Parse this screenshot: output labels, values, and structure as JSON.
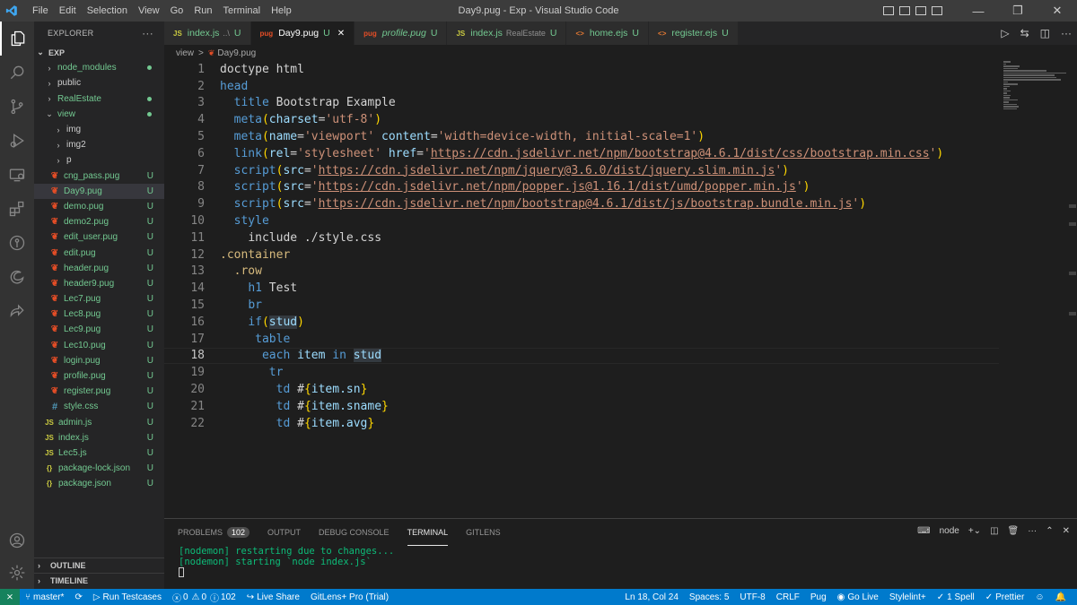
{
  "titlebar": {
    "menu": [
      "File",
      "Edit",
      "Selection",
      "View",
      "Go",
      "Run",
      "Terminal",
      "Help"
    ],
    "title": "Day9.pug - Exp - Visual Studio Code"
  },
  "sidebar": {
    "header": "EXPLORER",
    "more": "···",
    "root": "EXP",
    "items": [
      {
        "label": "node_modules",
        "type": "folder",
        "status": "dot"
      },
      {
        "label": "public",
        "type": "folder",
        "status": ""
      },
      {
        "label": "RealEstate",
        "type": "folder",
        "status": "dot"
      },
      {
        "label": "view",
        "type": "folder-open",
        "status": "dot"
      },
      {
        "label": "img",
        "type": "subfolder",
        "status": ""
      },
      {
        "label": "img2",
        "type": "subfolder",
        "status": ""
      },
      {
        "label": "p",
        "type": "subfolder",
        "status": ""
      },
      {
        "label": "cng_pass.pug",
        "type": "pug",
        "status": "U"
      },
      {
        "label": "Day9.pug",
        "type": "pug",
        "status": "U"
      },
      {
        "label": "demo.pug",
        "type": "pug",
        "status": "U"
      },
      {
        "label": "demo2.pug",
        "type": "pug",
        "status": "U"
      },
      {
        "label": "edit_user.pug",
        "type": "pug",
        "status": "U"
      },
      {
        "label": "edit.pug",
        "type": "pug",
        "status": "U"
      },
      {
        "label": "header.pug",
        "type": "pug",
        "status": "U"
      },
      {
        "label": "header9.pug",
        "type": "pug",
        "status": "U"
      },
      {
        "label": "Lec7.pug",
        "type": "pug",
        "status": "U"
      },
      {
        "label": "Lec8.pug",
        "type": "pug",
        "status": "U"
      },
      {
        "label": "Lec9.pug",
        "type": "pug",
        "status": "U"
      },
      {
        "label": "Lec10.pug",
        "type": "pug",
        "status": "U"
      },
      {
        "label": "login.pug",
        "type": "pug",
        "status": "U"
      },
      {
        "label": "profile.pug",
        "type": "pug",
        "status": "U"
      },
      {
        "label": "register.pug",
        "type": "pug",
        "status": "U"
      },
      {
        "label": "style.css",
        "type": "css",
        "status": "U"
      },
      {
        "label": "admin.js",
        "type": "js",
        "status": "U"
      },
      {
        "label": "index.js",
        "type": "js",
        "status": "U"
      },
      {
        "label": "Lec5.js",
        "type": "js",
        "status": "U"
      },
      {
        "label": "package-lock.json",
        "type": "json",
        "status": "U"
      },
      {
        "label": "package.json",
        "type": "json",
        "status": "U"
      }
    ],
    "outline": "OUTLINE",
    "timeline": "TIMELINE"
  },
  "tabs": [
    {
      "icon": "JS",
      "label": "index.js",
      "sub": "..\\",
      "status": "U",
      "active": false,
      "italic": false
    },
    {
      "icon": "pug",
      "label": "Day9.pug",
      "sub": "",
      "status": "U",
      "active": true,
      "italic": false
    },
    {
      "icon": "pug",
      "label": "profile.pug",
      "sub": "",
      "status": "U",
      "active": false,
      "italic": true
    },
    {
      "icon": "JS",
      "label": "index.js",
      "sub": "RealEstate",
      "status": "U",
      "active": false,
      "italic": false
    },
    {
      "icon": "<>",
      "label": "home.ejs",
      "sub": "",
      "status": "U",
      "active": false,
      "italic": false
    },
    {
      "icon": "<>",
      "label": "register.ejs",
      "sub": "",
      "status": "U",
      "active": false,
      "italic": false
    }
  ],
  "breadcrumb": {
    "folder": "view",
    "sep": ">",
    "file": "Day9.pug"
  },
  "code": {
    "current_line": 18,
    "lines": [
      [
        [
          "w",
          "doctype html"
        ]
      ],
      [
        [
          "k",
          "head"
        ]
      ],
      [
        [
          "w",
          "  "
        ],
        [
          "k",
          "title"
        ],
        [
          "w",
          " Bootstrap Example"
        ]
      ],
      [
        [
          "w",
          "  "
        ],
        [
          "k",
          "meta"
        ],
        [
          "br",
          "("
        ],
        [
          "v",
          "charset"
        ],
        [
          "w",
          "="
        ],
        [
          "s",
          "'utf-8'"
        ],
        [
          "br",
          ")"
        ]
      ],
      [
        [
          "w",
          "  "
        ],
        [
          "k",
          "meta"
        ],
        [
          "br",
          "("
        ],
        [
          "v",
          "name"
        ],
        [
          "w",
          "="
        ],
        [
          "s",
          "'viewport'"
        ],
        [
          "w",
          " "
        ],
        [
          "v",
          "content"
        ],
        [
          "w",
          "="
        ],
        [
          "s",
          "'width=device-width, initial-scale=1'"
        ],
        [
          "br",
          ")"
        ]
      ],
      [
        [
          "w",
          "  "
        ],
        [
          "k",
          "link"
        ],
        [
          "br",
          "("
        ],
        [
          "v",
          "rel"
        ],
        [
          "w",
          "="
        ],
        [
          "s",
          "'stylesheet'"
        ],
        [
          "w",
          " "
        ],
        [
          "v",
          "href"
        ],
        [
          "w",
          "="
        ],
        [
          "s",
          "'"
        ],
        [
          "su",
          "https://cdn.jsdelivr.net/npm/bootstrap@4.6.1/dist/css/bootstrap.min.css"
        ],
        [
          "s",
          "'"
        ],
        [
          "br",
          ")"
        ]
      ],
      [
        [
          "w",
          "  "
        ],
        [
          "k",
          "script"
        ],
        [
          "br",
          "("
        ],
        [
          "v",
          "src"
        ],
        [
          "w",
          "="
        ],
        [
          "s",
          "'"
        ],
        [
          "su",
          "https://cdn.jsdelivr.net/npm/jquery@3.6.0/dist/jquery.slim.min.js"
        ],
        [
          "s",
          "'"
        ],
        [
          "br",
          ")"
        ]
      ],
      [
        [
          "w",
          "  "
        ],
        [
          "k",
          "script"
        ],
        [
          "br",
          "("
        ],
        [
          "v",
          "src"
        ],
        [
          "w",
          "="
        ],
        [
          "s",
          "'"
        ],
        [
          "su",
          "https://cdn.jsdelivr.net/npm/popper.js@1.16.1/dist/umd/popper.min.js"
        ],
        [
          "s",
          "'"
        ],
        [
          "br",
          ")"
        ]
      ],
      [
        [
          "w",
          "  "
        ],
        [
          "k",
          "script"
        ],
        [
          "br",
          "("
        ],
        [
          "v",
          "src"
        ],
        [
          "w",
          "="
        ],
        [
          "s",
          "'"
        ],
        [
          "su",
          "https://cdn.jsdelivr.net/npm/bootstrap@4.6.1/dist/js/bootstrap.bundle.min.js"
        ],
        [
          "s",
          "'"
        ],
        [
          "br",
          ")"
        ]
      ],
      [
        [
          "w",
          "  "
        ],
        [
          "k",
          "style"
        ]
      ],
      [
        [
          "w",
          "    "
        ],
        [
          "w",
          "include ./style.css"
        ]
      ],
      [
        [
          "cls",
          ".container"
        ]
      ],
      [
        [
          "w",
          "  "
        ],
        [
          "cls",
          ".row"
        ]
      ],
      [
        [
          "w",
          "    "
        ],
        [
          "k",
          "h1"
        ],
        [
          "w",
          " Test"
        ]
      ],
      [
        [
          "w",
          "    "
        ],
        [
          "k",
          "br"
        ]
      ],
      [
        [
          "w",
          "    "
        ],
        [
          "k",
          "if"
        ],
        [
          "br",
          "("
        ],
        [
          "hl",
          "stud"
        ],
        [
          "br",
          ")"
        ]
      ],
      [
        [
          "w",
          "     "
        ],
        [
          "k",
          "table"
        ]
      ],
      [
        [
          "w",
          "      "
        ],
        [
          "kw",
          "each"
        ],
        [
          "w",
          " "
        ],
        [
          "v",
          "item"
        ],
        [
          "w",
          " "
        ],
        [
          "kw",
          "in"
        ],
        [
          "w",
          " "
        ],
        [
          "hlv",
          "stud"
        ]
      ],
      [
        [
          "w",
          "       "
        ],
        [
          "k",
          "tr"
        ]
      ],
      [
        [
          "w",
          "        "
        ],
        [
          "k",
          "td"
        ],
        [
          "w",
          " #"
        ],
        [
          "br",
          "{"
        ],
        [
          "v",
          "item.sn"
        ],
        [
          "br",
          "}"
        ]
      ],
      [
        [
          "w",
          "        "
        ],
        [
          "k",
          "td"
        ],
        [
          "w",
          " #"
        ],
        [
          "br",
          "{"
        ],
        [
          "v",
          "item.sname"
        ],
        [
          "br",
          "}"
        ]
      ],
      [
        [
          "w",
          "        "
        ],
        [
          "k",
          "td"
        ],
        [
          "w",
          " #"
        ],
        [
          "br",
          "{"
        ],
        [
          "v",
          "item.avg"
        ],
        [
          "br",
          "}"
        ]
      ]
    ]
  },
  "panel": {
    "tabs": [
      {
        "label": "PROBLEMS",
        "badge": "102",
        "active": false
      },
      {
        "label": "OUTPUT",
        "badge": "",
        "active": false
      },
      {
        "label": "DEBUG CONSOLE",
        "badge": "",
        "active": false
      },
      {
        "label": "TERMINAL",
        "badge": "",
        "active": true
      },
      {
        "label": "GITLENS",
        "badge": "",
        "active": false
      }
    ],
    "terminal_name": "node",
    "terminal_lines": [
      "[nodemon] restarting due to changes...",
      "[nodemon] starting `node index.js`"
    ]
  },
  "statusbar": {
    "left": [
      "master*",
      "Run Testcases",
      "0",
      "0",
      "102",
      "Live Share",
      "GitLens+ Pro (Trial)"
    ],
    "right": [
      "Ln 18, Col 24",
      "Spaces: 5",
      "UTF-8",
      "CRLF",
      "Pug",
      "Go Live",
      "Stylelint+",
      "1 Spell",
      "Prettier"
    ]
  },
  "colors": {
    "accent": "#007acc",
    "remote": "#16825d",
    "untracked": "#73c991"
  }
}
